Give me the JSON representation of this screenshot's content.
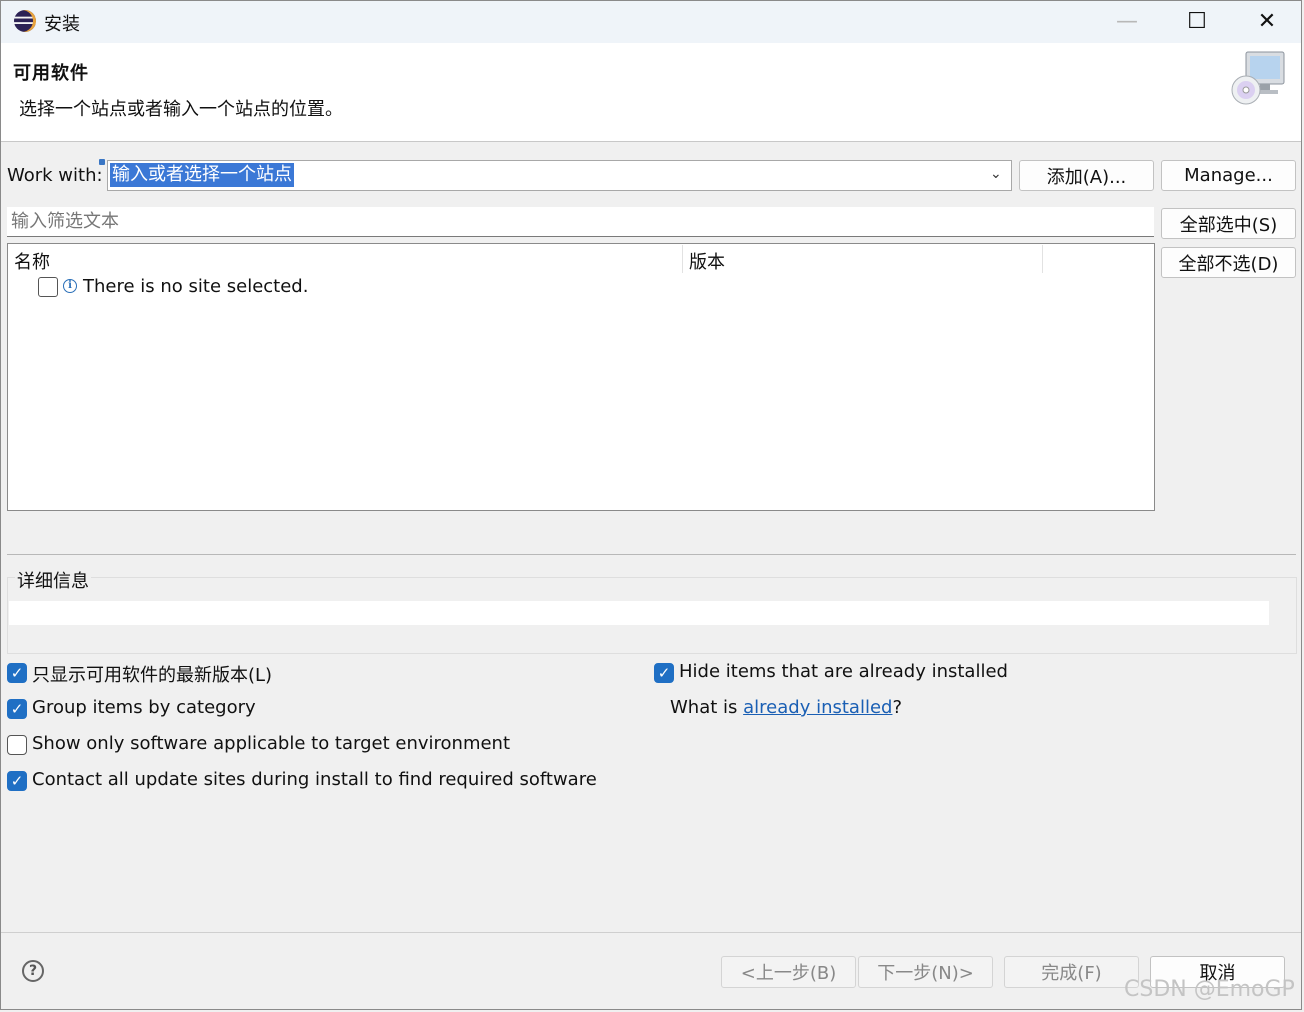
{
  "window": {
    "title": "安装",
    "minimize": "—",
    "maximize": "☐",
    "close": "✕"
  },
  "banner": {
    "title": "可用软件",
    "message": "选择一个站点或者输入一个站点的位置。"
  },
  "work_with": {
    "label": "Work with:",
    "value": "输入或者选择一个站点",
    "add_label": "添加(A)...",
    "manage_label": "Manage..."
  },
  "filter": {
    "placeholder": "输入筛选文本"
  },
  "side_buttons": {
    "select_all": "全部选中(S)",
    "deselect_all": "全部不选(D)"
  },
  "tree": {
    "columns": [
      "名称",
      "版本"
    ],
    "message": "There is no site selected.",
    "checked": false
  },
  "details": {
    "label": "详细信息",
    "text": ""
  },
  "options": {
    "latest_only": {
      "label": "只显示可用软件的最新版本(L)",
      "checked": true
    },
    "group_by_category": {
      "label": "Group items by category",
      "checked": true
    },
    "target_env": {
      "label": "Show only software applicable to target environment",
      "checked": false
    },
    "contact_sites": {
      "label": "Contact all update sites during install to find required software",
      "checked": true
    },
    "hide_installed": {
      "label": "Hide items that are already installed",
      "checked": true
    }
  },
  "installed": {
    "prefix": "What is ",
    "link": "already installed",
    "suffix": "?"
  },
  "footer": {
    "help": "?",
    "back": "<上一步(B)",
    "next": "下一步(N)>",
    "finish": "完成(F)",
    "cancel": "取消"
  },
  "watermark": "CSDN @EmoGP",
  "colors": {
    "accent": "#1f6fc4",
    "link": "#1a5fb4",
    "selection": "#3b78d6"
  },
  "icons": {
    "app": "eclipse-icon",
    "info": "info-icon",
    "help": "help-icon",
    "dropdown": "chevron-down-icon"
  }
}
